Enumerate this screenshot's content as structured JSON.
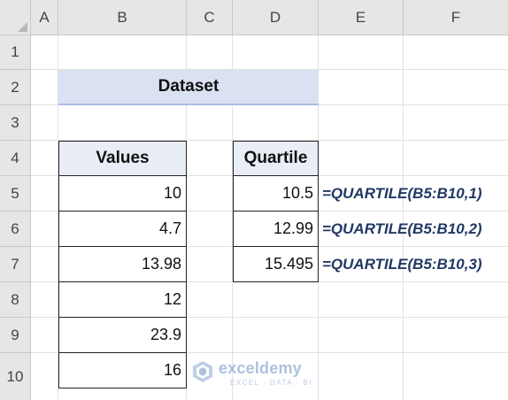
{
  "columns": [
    "A",
    "B",
    "C",
    "D",
    "E",
    "F"
  ],
  "rows": [
    "1",
    "2",
    "3",
    "4",
    "5",
    "6",
    "7",
    "8",
    "9",
    "10"
  ],
  "title": "Dataset",
  "values_table": {
    "header": "Values",
    "items": [
      "10",
      "4.7",
      "13.98",
      "12",
      "23.9",
      "16"
    ]
  },
  "quartile_table": {
    "header": "Quartile",
    "items": [
      "10.5",
      "12.99",
      "15.495"
    ]
  },
  "formulas": [
    "=QUARTILE(B5:B10,1)",
    "=QUARTILE(B5:B10,2)",
    "=QUARTILE(B5:B10,3)"
  ],
  "watermark": {
    "name": "exceldemy",
    "tagline": "EXCEL · DATA · BI",
    "color": "#6b8fc4"
  }
}
